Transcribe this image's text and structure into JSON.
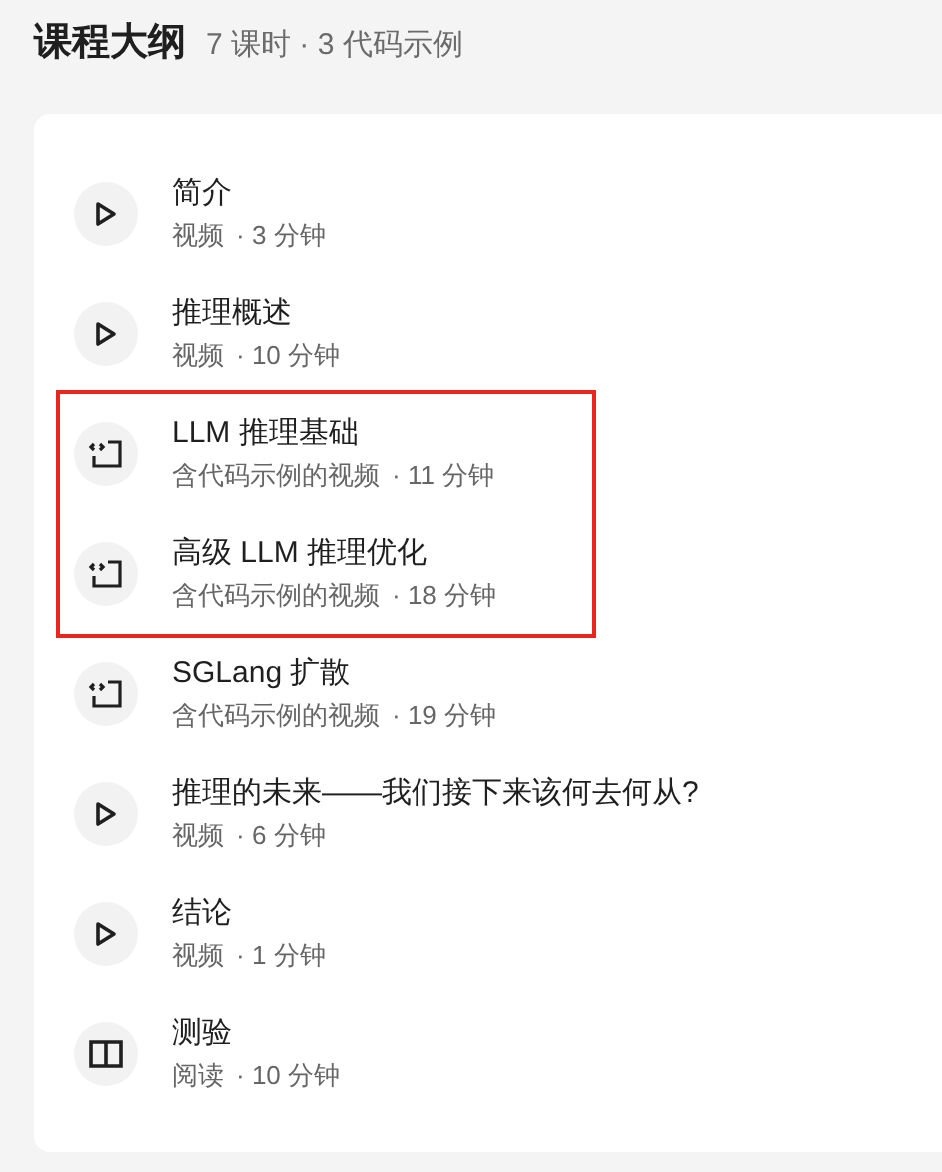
{
  "header": {
    "title": "课程大纲",
    "summary": "7 课时 · 3 代码示例"
  },
  "lessons": [
    {
      "kind": "video",
      "title": "简介",
      "type": "视频",
      "duration": "· 3 分钟",
      "highlighted": false
    },
    {
      "kind": "video",
      "title": "推理概述",
      "type": "视频",
      "duration": "· 10 分钟",
      "highlighted": false
    },
    {
      "kind": "code",
      "title": "LLM 推理基础",
      "type": "含代码示例的视频",
      "duration": "· 11 分钟",
      "highlighted": true
    },
    {
      "kind": "code",
      "title": "高级 LLM 推理优化",
      "type": "含代码示例的视频",
      "duration": "· 18 分钟",
      "highlighted": true
    },
    {
      "kind": "code",
      "title": "SGLang 扩散",
      "type": "含代码示例的视频",
      "duration": "· 19 分钟",
      "highlighted": false
    },
    {
      "kind": "video",
      "title": "推理的未来——我们接下来该何去何从?",
      "type": "视频",
      "duration": "· 6 分钟",
      "highlighted": false
    },
    {
      "kind": "video",
      "title": "结论",
      "type": "视频",
      "duration": "· 1 分钟",
      "highlighted": false
    },
    {
      "kind": "reading",
      "title": "测验",
      "type": "阅读",
      "duration": "· 10 分钟",
      "highlighted": false
    }
  ]
}
